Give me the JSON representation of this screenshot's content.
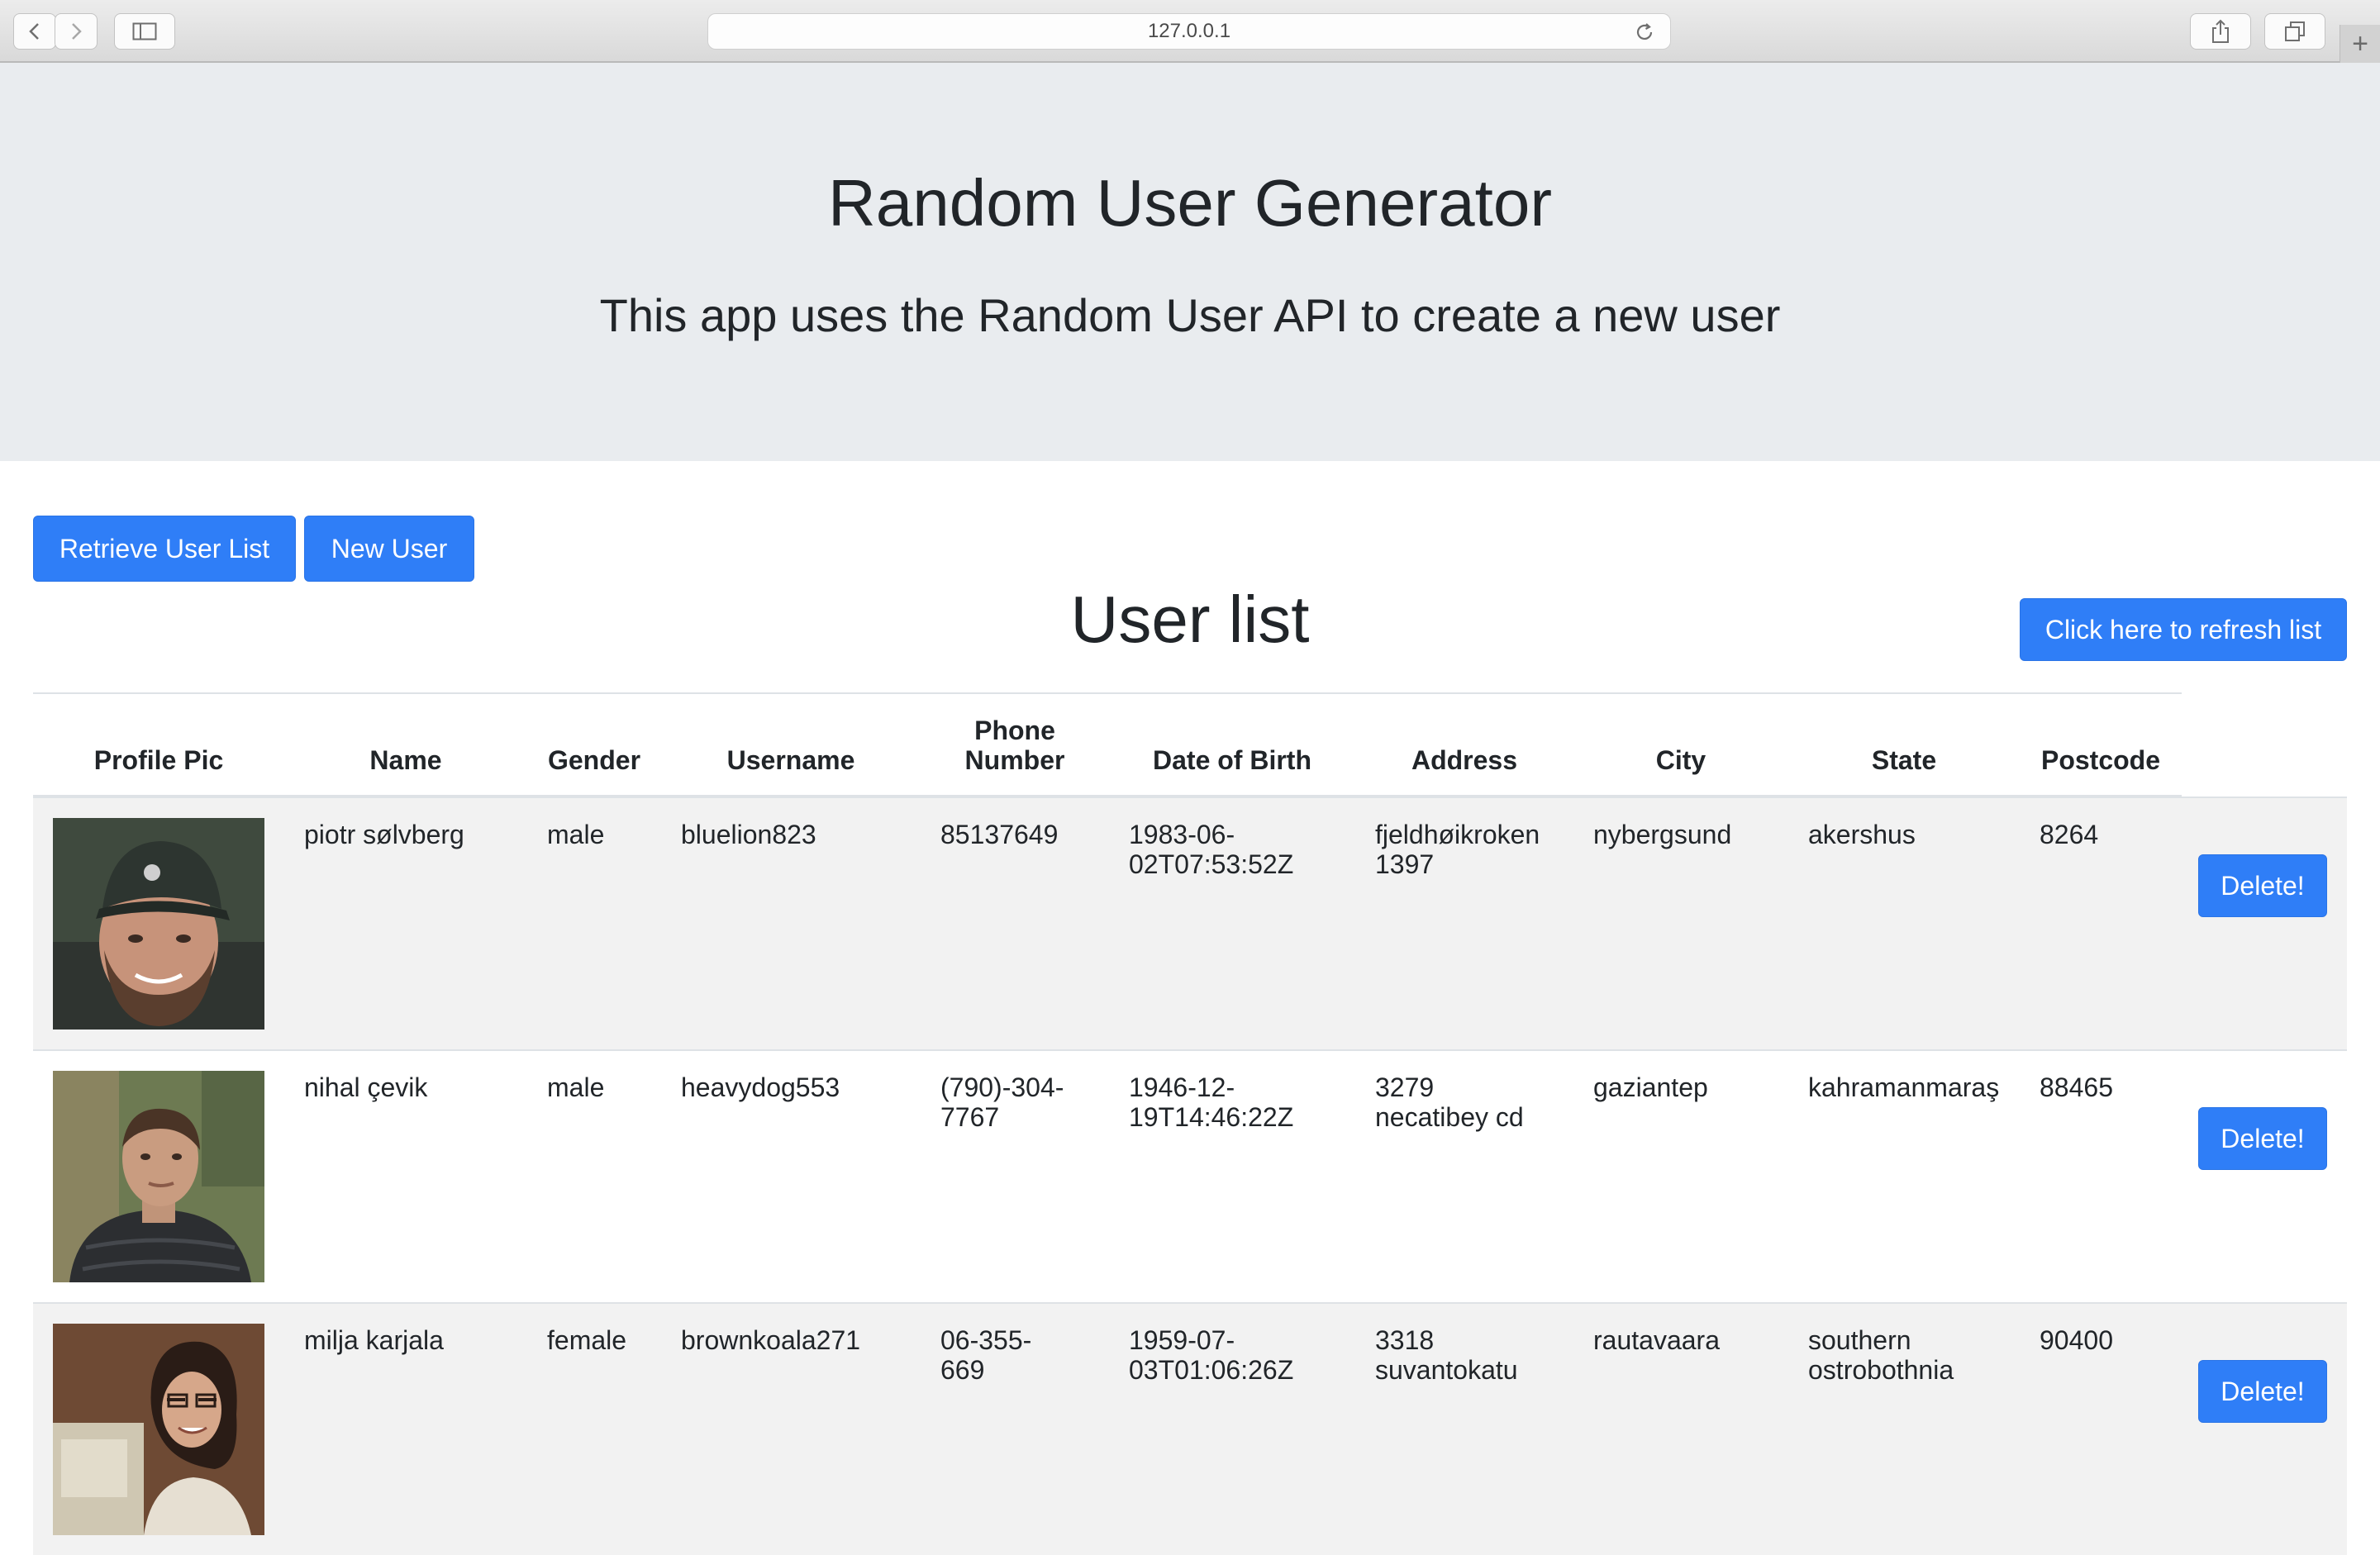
{
  "browser": {
    "url": "127.0.0.1",
    "new_tab_symbol": "+"
  },
  "header": {
    "title": "Random User Generator",
    "subtitle": "This app uses the Random User API to create a new user"
  },
  "actions": {
    "retrieve_label": "Retrieve User List",
    "new_user_label": "New User",
    "refresh_label": "Click here to refresh list"
  },
  "list": {
    "title": "User list",
    "columns": [
      "Profile Pic",
      "Name",
      "Gender",
      "Username",
      "Phone\nNumber",
      "Date of Birth",
      "Address",
      "City",
      "State",
      "Postcode"
    ],
    "delete_label": "Delete!",
    "rows": [
      {
        "name": "piotr sølvberg",
        "gender": "male",
        "username": "bluelion823",
        "phone": "85137649",
        "dob": "1983-06-\n02T07:53:52Z",
        "address": "fjeldhøikroken\n1397",
        "city": "nybergsund",
        "state": "akershus",
        "postcode": "8264"
      },
      {
        "name": "nihal çevik",
        "gender": "male",
        "username": "heavydog553",
        "phone": "(790)-304-\n7767",
        "dob": "1946-12-\n19T14:46:22Z",
        "address": "3279\nnecatibey cd",
        "city": "gaziantep",
        "state": "kahramanmaraş",
        "postcode": "88465"
      },
      {
        "name": "milja karjala",
        "gender": "female",
        "username": "brownkoala271",
        "phone": "06-355-\n669",
        "dob": "1959-07-\n03T01:06:26Z",
        "address": "3318\nsuvantokatu",
        "city": "rautavaara",
        "state": "southern\nostrobothnia",
        "postcode": "90400"
      }
    ]
  },
  "colors": {
    "primary": "#2f7ef7",
    "jumbotron_bg": "#e9ecef",
    "stripe_bg": "#f2f2f2",
    "text": "#212529"
  }
}
